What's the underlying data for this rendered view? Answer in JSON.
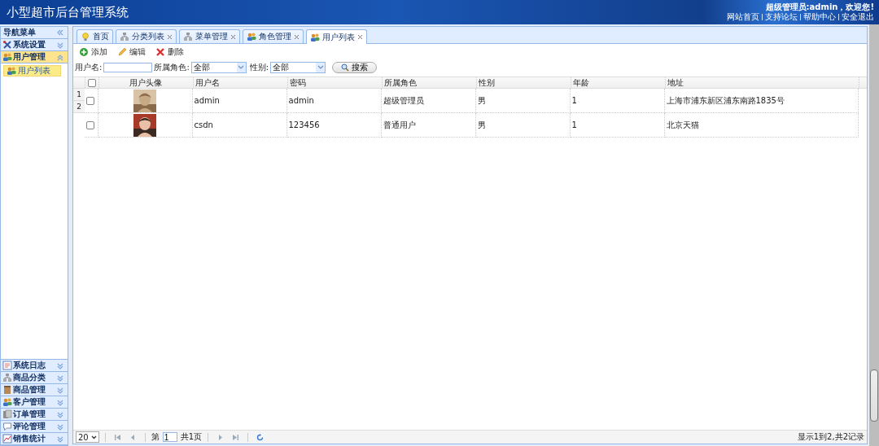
{
  "header": {
    "title": "小型超市后台管理系统",
    "welcome": "超级管理员:admin，欢迎您!",
    "links": [
      "网站首页",
      "支持论坛",
      "帮助中心",
      "安全退出"
    ]
  },
  "sidebar": {
    "title": "导航菜单",
    "sections": [
      {
        "title": "系统设置",
        "expanded": false
      },
      {
        "title": "用户管理",
        "expanded": true,
        "children": [
          {
            "label": "用户列表",
            "selected": true
          }
        ]
      },
      {
        "title": "系统日志",
        "expanded": false
      },
      {
        "title": "商品分类",
        "expanded": false
      },
      {
        "title": "商品管理",
        "expanded": false
      },
      {
        "title": "客户管理",
        "expanded": false
      },
      {
        "title": "订单管理",
        "expanded": false
      },
      {
        "title": "评论管理",
        "expanded": false
      },
      {
        "title": "销售统计",
        "expanded": false
      }
    ]
  },
  "tabs": [
    {
      "label": "首页",
      "closable": false,
      "selected": false
    },
    {
      "label": "分类列表",
      "closable": true,
      "selected": false
    },
    {
      "label": "菜单管理",
      "closable": true,
      "selected": false
    },
    {
      "label": "角色管理",
      "closable": true,
      "selected": false
    },
    {
      "label": "用户列表",
      "closable": true,
      "selected": true
    }
  ],
  "toolbar": [
    "添加",
    "编辑",
    "删除"
  ],
  "search": {
    "fields": [
      {
        "label": "用户名:",
        "kind": "text"
      },
      {
        "label": "所属角色:",
        "kind": "select",
        "value": "全部"
      },
      {
        "label": "性别:",
        "kind": "select",
        "value": "全部"
      }
    ],
    "button": "搜索"
  },
  "table": {
    "columns": [
      {
        "kind": "checkbox",
        "checked": false
      },
      "用户头像",
      "用户名",
      "密码",
      "所属角色",
      "性别",
      "年龄",
      "地址"
    ],
    "rows": [
      {
        "number": "1",
        "cells": [
          {
            "kind": "checkbox",
            "checked": false
          },
          {
            "kind": "picture"
          },
          "admin",
          "admin",
          "超级管理员",
          "男",
          "1",
          "上海市浦东新区浦东南路1835号"
        ]
      },
      {
        "number": "2",
        "cells": [
          {
            "kind": "checkbox",
            "checked": false
          },
          {
            "kind": "picture"
          },
          "csdn",
          "123456",
          "普通用户",
          "男",
          "1",
          "北京天猫"
        ]
      }
    ]
  },
  "pager": {
    "page_size": "20",
    "before": "第",
    "page": "1",
    "after": "共1页",
    "summary": "显示1到2,共2记录"
  }
}
